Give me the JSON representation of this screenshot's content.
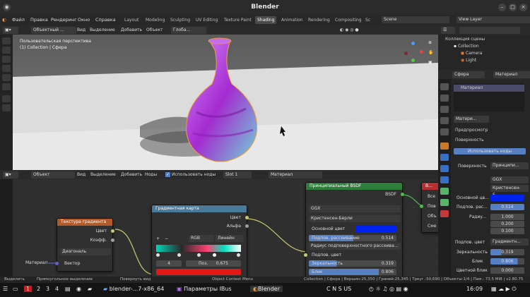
{
  "title": "Blender",
  "menu": [
    "Файл",
    "Правка",
    "Рендеринг",
    "Окно",
    "Справка"
  ],
  "workspaces": [
    "Layout",
    "Modeling",
    "Sculpting",
    "UV Editing",
    "Texture Paint",
    "Shading",
    "Animation",
    "Rendering",
    "Compositing",
    "Sc"
  ],
  "active_workspace": "Shading",
  "scene_label": "Scene",
  "view_layer_label": "View Layer",
  "viewport_header": {
    "mode": "Объектный ...",
    "view": "Вид",
    "select": "Выделение",
    "add": "Добавить",
    "object": "Объект",
    "transform": "Глоба..."
  },
  "viewport": {
    "perspective": "Пользовательская перспектива",
    "collection": "(1) Collection | Сфера"
  },
  "outliner": {
    "title": "Коллекция сцены",
    "items": [
      "Collection",
      "Camera",
      "Light"
    ]
  },
  "props_tabs": {
    "object": "Сфера",
    "material": "Материал"
  },
  "props": {
    "material_slot": "Материал",
    "material_name": "Матери...",
    "preview": "Предпросмотр",
    "surface": "Поверхность",
    "use_nodes": "Использовать ноды",
    "surface_label": "Поверхность",
    "surface_value": "Принципи...",
    "ggx": "GGX",
    "christensen": "Кристенсен-Б...",
    "base_color": "Основной цв...",
    "subsurface": "Подпов. рас...",
    "subsurface_value": "0.514",
    "radius": "Радиу...",
    "radius_values": [
      "1.000",
      "0.200",
      "0.100"
    ],
    "subsurface_color": "Подпов. цвет",
    "subsurface_color_value": "Градиентн...",
    "specular": "Зеркальность",
    "specular_value": "0.319",
    "glare": "Блик",
    "glare_value": "0.806",
    "specular_tint": "Цветной блик",
    "specular_tint_value": "0.000"
  },
  "node_header": {
    "mode": "Объект",
    "view": "Вид",
    "select": "Выделение",
    "add": "Добавить",
    "node": "Ноды",
    "use_nodes": "Использовать ноды",
    "slot": "Slot 1",
    "material": "Материал"
  },
  "nodes": {
    "gradient_tex": {
      "title": "Текстура градиента",
      "color": "Цвет",
      "fac": "Коэфф.",
      "type": "Диагональ",
      "vector": "Вектор"
    },
    "color_ramp": {
      "title": "Градиентная карта",
      "color": "Цвет",
      "alpha": "Альфа",
      "mode": "RGB",
      "interp": "Линейн",
      "index": "4",
      "pos_label": "Поз.",
      "pos_value": "0.675"
    },
    "bsdf": {
      "title": "Принципиальный BSDF",
      "out": "BSDF",
      "dist": "GGX",
      "sss_method": "Кристенсен-Берли",
      "base_color": "Основной цвет",
      "subsurface": "Подпов. рассеивание",
      "subsurface_value": "0.514",
      "sss_radius": "Радиус подповерхностного рассеива...",
      "sss_color": "Подпов. цвет",
      "specular": "Зеркальность",
      "specular_value": "0.319",
      "glare": "Блик",
      "glare_value": "0.806"
    },
    "output": {
      "title": "В...",
      "rows": [
        "Все",
        "Пов",
        "Объ",
        "Сме"
      ]
    },
    "material_label": "Материал"
  },
  "statusbar": {
    "select": "Выделить",
    "box": "Прямоугольное выделение",
    "rotate": "Повернуть вид",
    "context": "Object Context Menu",
    "stats": "Collection | Сфера | Вершин:25,350 | Граней:25,345 | Треуг.:50,690 | Объекты:1/4 | Пам.: 73.5 MiB | v2.80.75"
  },
  "taskbar": {
    "ws": [
      "1",
      "2",
      "3",
      "4"
    ],
    "apps": [
      "blender-...7-x86_64",
      "Параметры IBus",
      "Blender"
    ],
    "indicator": "C N S US",
    "clock": "16:09"
  },
  "colors": {
    "accent": "#5680c2",
    "node_color": "#b53030",
    "shader_green": "#2f7d3a",
    "base_color": "#0022ee"
  }
}
